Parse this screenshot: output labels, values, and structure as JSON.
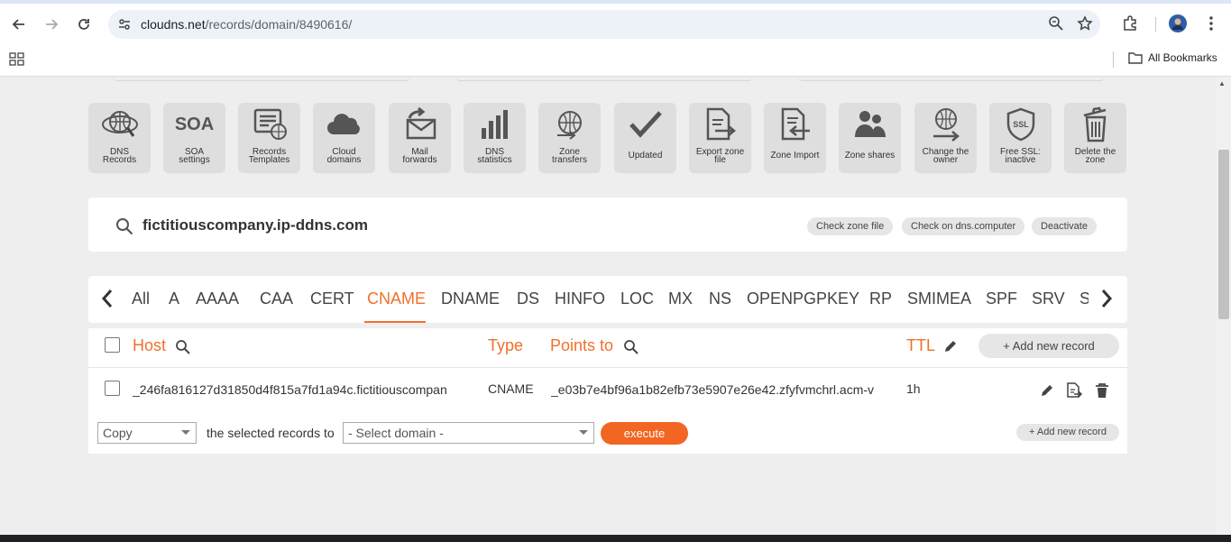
{
  "browser": {
    "url_host": "cloudns.net",
    "url_path": "/records/domain/8490616/",
    "all_bookmarks": "All Bookmarks"
  },
  "tools": [
    {
      "label1": "DNS",
      "label2": "Records",
      "icon": "globe-mouse-icon"
    },
    {
      "label1": "SOA",
      "label2": "settings",
      "icon": "soa-text-icon",
      "glyph": "SOA"
    },
    {
      "label1": "Records",
      "label2": "Templates",
      "icon": "template-globe-icon"
    },
    {
      "label1": "Cloud",
      "label2": "domains",
      "icon": "cloud-icon"
    },
    {
      "label1": "Mail",
      "label2": "forwards",
      "icon": "mail-forward-icon"
    },
    {
      "label1": "DNS",
      "label2": "statistics",
      "icon": "bar-chart-icon"
    },
    {
      "label1": "Zone",
      "label2": "transfers",
      "icon": "globe-transfer-icon"
    },
    {
      "label1": "Updated",
      "label2": "",
      "icon": "checkmark-icon"
    },
    {
      "label1": "Export zone",
      "label2": "file",
      "icon": "export-file-icon"
    },
    {
      "label1": "Zone Import",
      "label2": "",
      "icon": "import-file-icon"
    },
    {
      "label1": "Zone shares",
      "label2": "",
      "icon": "users-icon"
    },
    {
      "label1": "Change the",
      "label2": "owner",
      "icon": "globe-arrow-icon"
    },
    {
      "label1": "Free SSL:",
      "label2": "inactive",
      "icon": "ssl-shield-icon",
      "glyph": "SSL"
    },
    {
      "label1": "Delete the",
      "label2": "zone",
      "icon": "trash-can-icon"
    }
  ],
  "zone": {
    "name": "fictitiouscompany.ip-ddns.com",
    "check_zone_file": "Check zone file",
    "check_dns_computer": "Check on dns.computer",
    "deactivate": "Deactivate"
  },
  "record_tabs": [
    "All",
    "A",
    "AAAA",
    "CAA",
    "CERT",
    "CNAME",
    "DNAME",
    "DS",
    "HINFO",
    "LOC",
    "MX",
    "NS",
    "OPENPGPKEY",
    "RP",
    "SMIMEA",
    "SPF",
    "SRV",
    "S"
  ],
  "active_tab": "CNAME",
  "table": {
    "headers": {
      "host": "Host",
      "type": "Type",
      "points_to": "Points to",
      "ttl": "TTL"
    },
    "add_new_record": "+ Add new record",
    "rows": [
      {
        "host": "_246fa816127d31850d4f815a7fd1a94c.fictitiouscompan",
        "type": "CNAME",
        "points_to": "_e03b7e4bf96a1b82efb73e5907e26e42.zfyfvmchrl.acm-v",
        "ttl": "1h"
      }
    ]
  },
  "footer": {
    "action_select": "Copy",
    "selected_text": "the selected records to",
    "domain_select": "- Select domain -",
    "execute": "execute",
    "add_new_record": "+ Add new record"
  },
  "colors": {
    "accent": "#f26f2a",
    "execute_bg": "#f26522",
    "tile_bg": "#dedede"
  }
}
